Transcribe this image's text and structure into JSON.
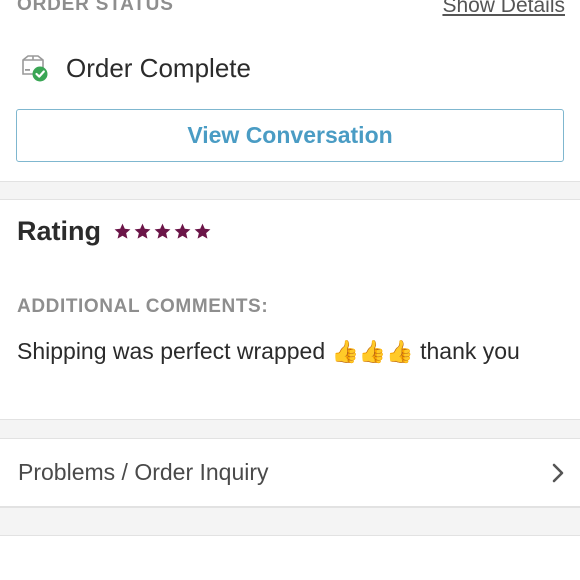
{
  "order_status": {
    "section_label": "ORDER STATUS",
    "show_details_label": "Show Details",
    "status_text": "Order Complete",
    "status_icon": "box-check-icon",
    "view_conversation_label": "View Conversation"
  },
  "rating": {
    "label": "Rating",
    "stars": 5,
    "max_stars": 5,
    "star_color": "#6b1548"
  },
  "comments": {
    "label": "ADDITIONAL COMMENTS:",
    "text_before": "Shipping was perfect wrapped",
    "emoji": "👍👍👍",
    "text_after": "thank you"
  },
  "inquiry": {
    "label": "Problems / Order Inquiry",
    "icon": "chevron-right-icon"
  },
  "colors": {
    "accent_blue": "#4a9cc4",
    "button_border": "#7fb7cf",
    "check_green": "#3aa655",
    "muted_text": "#8e8e8e"
  }
}
